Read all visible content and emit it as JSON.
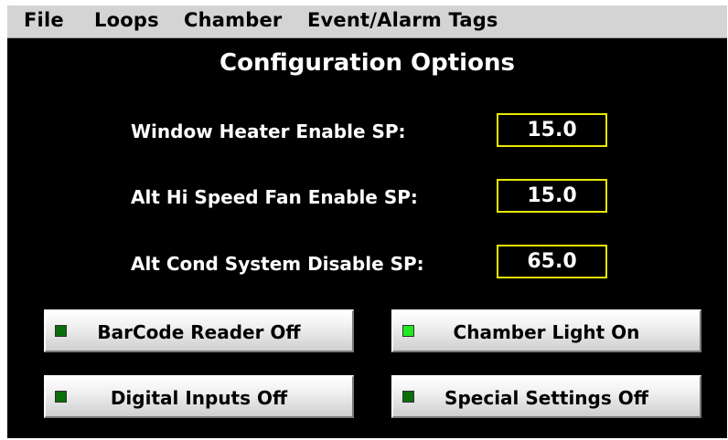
{
  "menu": {
    "file": "File",
    "loops": "Loops",
    "chamber": "Chamber",
    "event_alarm_tags": "Event/Alarm Tags"
  },
  "title": "Configuration Options",
  "setpoints": [
    {
      "label": "Window Heater Enable SP:",
      "value": "15.0"
    },
    {
      "label": "Alt Hi Speed Fan Enable SP:",
      "value": "15.0"
    },
    {
      "label": "Alt Cond System Disable SP:",
      "value": "65.0"
    }
  ],
  "buttons": [
    {
      "label": "BarCode Reader Off",
      "state": "off",
      "led_color": "#0a6e0a"
    },
    {
      "label": "Chamber Light On",
      "state": "on",
      "led_color": "#22e822"
    },
    {
      "label": "Digital Inputs Off",
      "state": "off",
      "led_color": "#0a6e0a"
    },
    {
      "label": "Special Settings Off",
      "state": "off",
      "led_color": "#0a6e0a"
    }
  ],
  "colors": {
    "setpoint_border": "#e8e800",
    "panel_background": "#000000",
    "menubar_background": "#d4d4d4"
  }
}
